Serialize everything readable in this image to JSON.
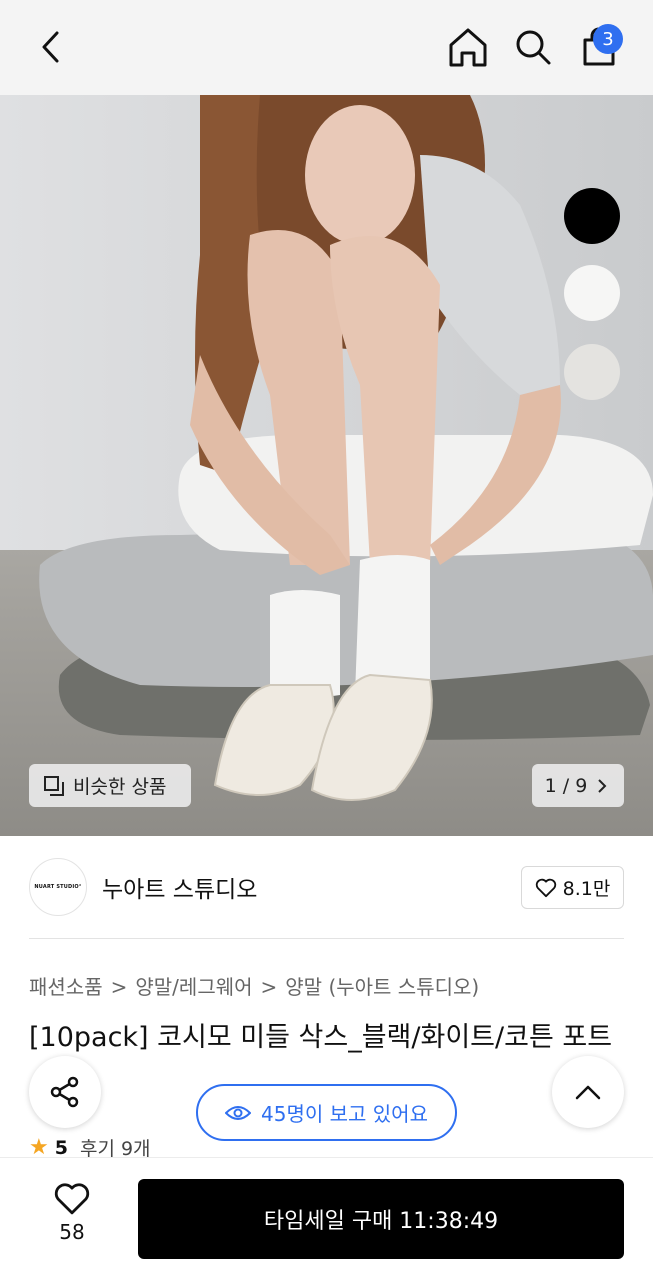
{
  "header": {
    "back_icon": "chevron-left-icon",
    "home_icon": "home-icon",
    "search_icon": "search-icon",
    "cart_icon": "shopping-bag-icon",
    "cart_count": "3"
  },
  "gallery": {
    "color_swatches": [
      {
        "name": "black",
        "color": "#000000"
      },
      {
        "name": "white",
        "color": "#f6f6f5"
      },
      {
        "name": "gray",
        "color": "#e4e3e0"
      }
    ],
    "similar_label": "비슷한 상품",
    "page_counter": "1 / 9",
    "page_current": 1,
    "page_total": 9
  },
  "brand": {
    "logo_text": "NUART STUDIO°",
    "name": "누아트 스튜디오",
    "likes": "8.1만"
  },
  "breadcrumb": [
    "패션소품",
    "양말/레그웨어",
    "양말 (누아트 스튜디오)"
  ],
  "product": {
    "title": "[10pack] 코시모 미들 삭스_블랙/화이트/코튼 포트",
    "rating_score": "5",
    "reviews_label": "후기 9개"
  },
  "floating": {
    "viewers_label": "45명이 보고 있어요"
  },
  "bottom_bar": {
    "wish_count": "58",
    "buy_label": "타임세일 구매 11:38:49"
  },
  "colors": {
    "accent": "#2f6ff0",
    "star": "#f5a623",
    "buy_button": "#000000"
  }
}
